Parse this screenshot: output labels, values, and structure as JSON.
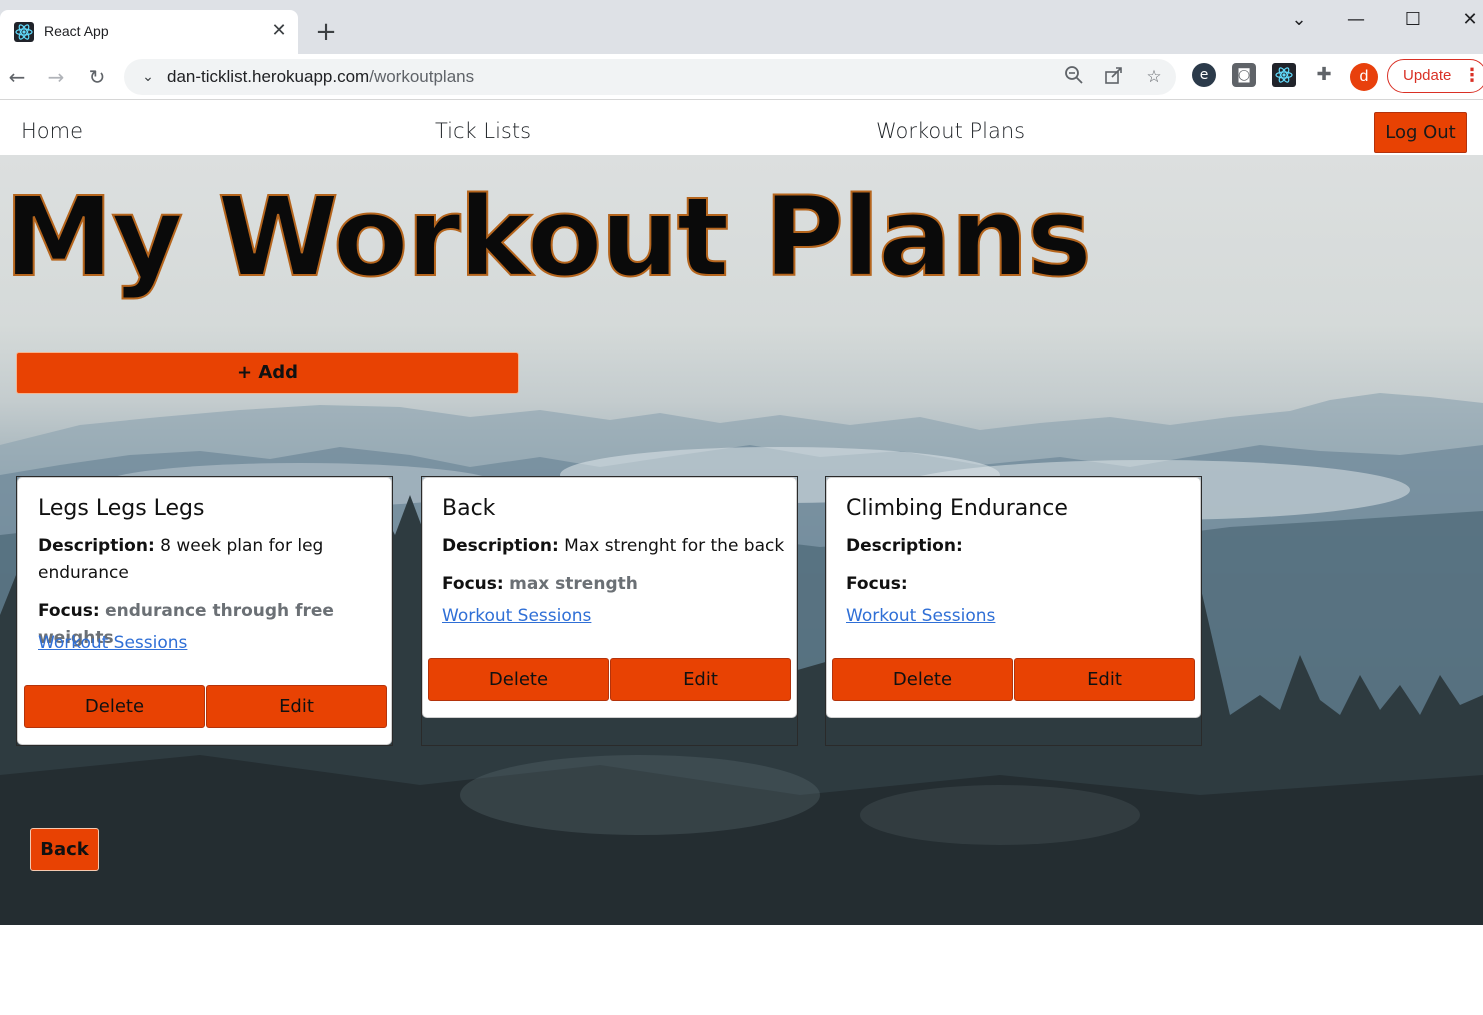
{
  "browser": {
    "tab_title": "React App",
    "tab_close": "✕",
    "new_tab": "+",
    "url_host": "dan-ticklist.herokuapp.com",
    "url_path": "/workoutplans",
    "update_label": "Update",
    "profile_initial": "d",
    "window_controls": {
      "minimize": "—",
      "maximize": "☐",
      "close": "✕",
      "tabsearch": "⌄"
    }
  },
  "navbar": {
    "links": [
      "Home",
      "Tick Lists",
      "Workout Plans"
    ],
    "logout_label": "Log Out"
  },
  "page": {
    "title": "My Workout Plans",
    "add_label": "+ Add",
    "back_label": "Back"
  },
  "plans": [
    {
      "title": "Legs Legs Legs",
      "description_label": "Description:",
      "description": "8 week plan for leg",
      "description_cont": "endurance",
      "focus_label": "Focus:",
      "focus": "endurance through free weights",
      "sessions_link": "Workout Sessions",
      "delete_label": "Delete",
      "edit_label": "Edit"
    },
    {
      "title": "Back",
      "description_label": "Description:",
      "description": "Max strenght for the back",
      "focus_label": "Focus:",
      "focus": "max strength",
      "sessions_link": "Workout Sessions",
      "delete_label": "Delete",
      "edit_label": "Edit"
    },
    {
      "title": "Climbing Endurance",
      "description_label": "Description:",
      "description": "",
      "focus_label": "Focus:",
      "focus": "",
      "sessions_link": "Workout Sessions",
      "delete_label": "Delete",
      "edit_label": "Edit"
    }
  ],
  "colors": {
    "accent": "#e84203",
    "link": "#2f6fd6",
    "update_red": "#d93025"
  }
}
